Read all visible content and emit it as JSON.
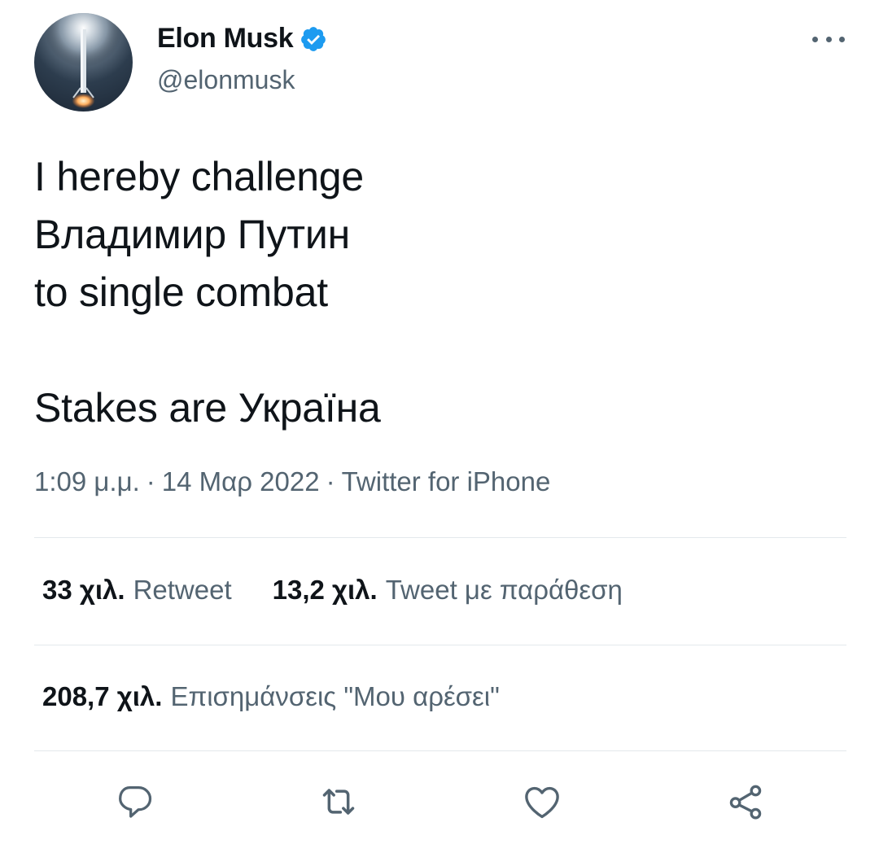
{
  "author": {
    "display_name": "Elon Musk",
    "handle": "@elonmusk",
    "verified": true,
    "verified_color": "#1d9bf0"
  },
  "tweet": {
    "lines": [
      "I hereby challenge",
      "Владимир Путин",
      "to single combat",
      "",
      "Stakes are Україна"
    ]
  },
  "meta": {
    "time": "1:09 μ.μ.",
    "separator": "·",
    "date": "14 Μαρ 2022",
    "source": "Twitter for iPhone"
  },
  "stats": {
    "retweets_count": "33 χιλ.",
    "retweets_label": "Retweet",
    "quotes_count": "13,2 χιλ.",
    "quotes_label": "Tweet με παράθεση",
    "likes_count": "208,7 χιλ.",
    "likes_label": "Επισημάνσεις \"Μου αρέσει\""
  },
  "actions": [
    {
      "icon": "reply-icon"
    },
    {
      "icon": "retweet-icon"
    },
    {
      "icon": "like-icon"
    },
    {
      "icon": "share-icon"
    }
  ],
  "colors": {
    "text_primary": "#0f1419",
    "text_secondary": "#536471",
    "divider": "#e3e8ec"
  }
}
